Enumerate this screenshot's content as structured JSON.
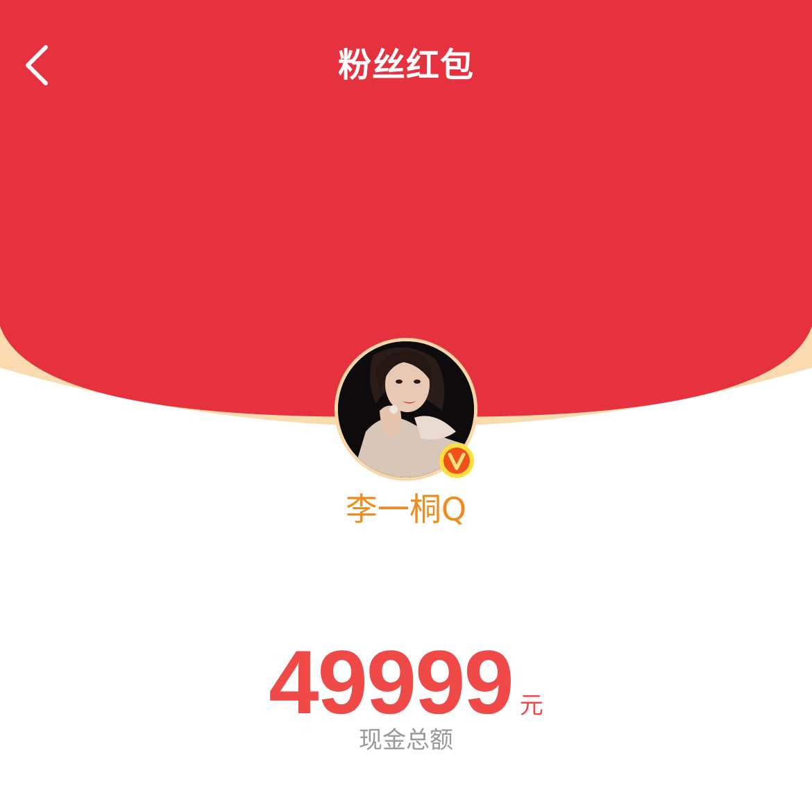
{
  "header": {
    "title": "粉丝红包",
    "back_icon": "chevron-left-icon"
  },
  "profile": {
    "username": "李一桐Q",
    "verified_icon": "verified-v-icon"
  },
  "reward": {
    "amount": "49999",
    "unit": "元",
    "label": "现金总额"
  },
  "colors": {
    "header_red": "#e6323f",
    "curve_gold": "#fadbb0",
    "username_orange": "#f08c1e",
    "amount_red": "#f04a48",
    "label_gray": "#999999"
  }
}
